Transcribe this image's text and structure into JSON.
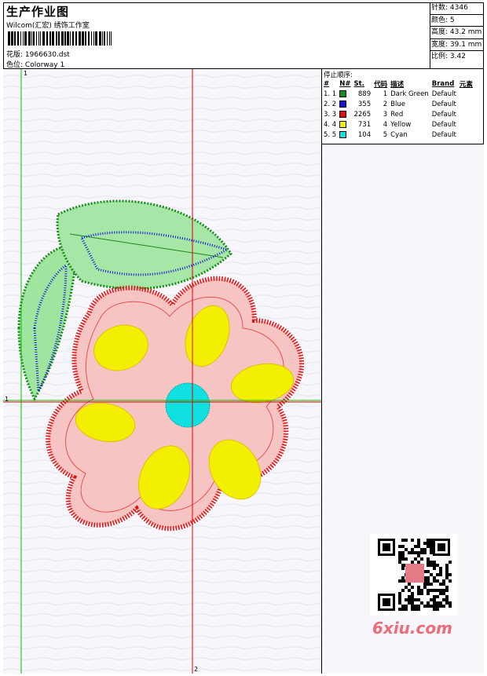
{
  "header": {
    "title": "生产作业图",
    "studio": "Wilcom(汇宏) 绣饰工作室",
    "design_label": "花版:",
    "design_file": "1966630.dst",
    "colorway_label": "色位:",
    "colorway": "Colorway 1"
  },
  "stats": {
    "stitches": "针数: 4346",
    "colors": "颜色: 5",
    "height": "高度: 43.2 mm",
    "width": "宽度: 39.1 mm",
    "ratio": "比例: 3.42"
  },
  "sequence": {
    "title": "停止顺序:",
    "headers": [
      "#",
      "N#",
      "St.",
      "代码",
      "描述",
      "Brand",
      "元素"
    ],
    "rows": [
      {
        "idx": "1. 1",
        "color": "#1a8a1a",
        "st": "889",
        "code": "1",
        "desc": "Dark Green",
        "brand": "Default"
      },
      {
        "idx": "2. 2",
        "color": "#1414d2",
        "st": "355",
        "code": "2",
        "desc": "Blue",
        "brand": "Default"
      },
      {
        "idx": "3. 3",
        "color": "#e01010",
        "st": "2265",
        "code": "3",
        "desc": "Red",
        "brand": "Default"
      },
      {
        "idx": "4. 4",
        "color": "#f2f000",
        "st": "731",
        "code": "4",
        "desc": "Yellow",
        "brand": "Default"
      },
      {
        "idx": "5. 5",
        "color": "#10e0e0",
        "st": "104",
        "code": "5",
        "desc": "Cyan",
        "brand": "Default"
      }
    ]
  },
  "canvas": {
    "guide_labels": [
      "1",
      "1",
      "2"
    ]
  },
  "watermark": "6xiu.com"
}
